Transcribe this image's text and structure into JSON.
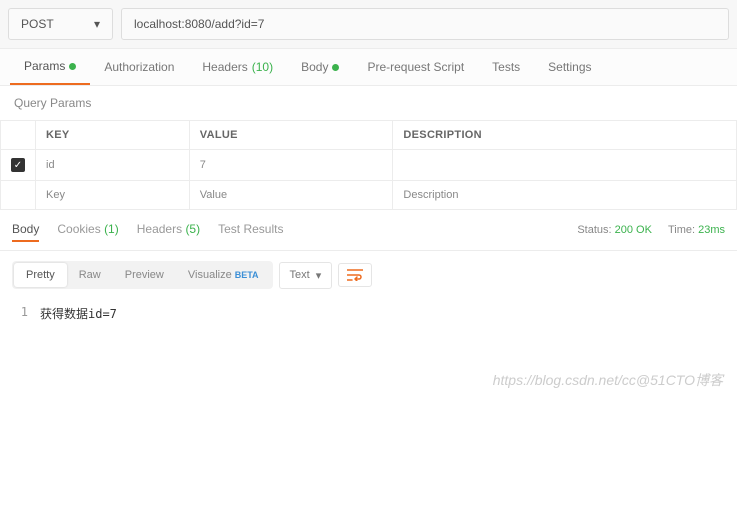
{
  "request": {
    "method": "POST",
    "url": "localhost:8080/add?id=7"
  },
  "reqTabs": {
    "params": "Params",
    "authorization": "Authorization",
    "headers": "Headers",
    "headersCount": "(10)",
    "body": "Body",
    "preRequest": "Pre-request Script",
    "tests": "Tests",
    "settings": "Settings"
  },
  "queryParams": {
    "title": "Query Params",
    "headers": {
      "key": "KEY",
      "value": "VALUE",
      "desc": "DESCRIPTION"
    },
    "rows": [
      {
        "checked": true,
        "key": "id",
        "value": "7",
        "desc": ""
      }
    ],
    "placeholder": {
      "key": "Key",
      "value": "Value",
      "desc": "Description"
    }
  },
  "respTabs": {
    "body": "Body",
    "cookies": "Cookies",
    "cookiesCount": "(1)",
    "headers": "Headers",
    "headersCount": "(5)",
    "testResults": "Test Results"
  },
  "respMeta": {
    "statusLabel": "Status:",
    "statusValue": "200 OK",
    "timeLabel": "Time:",
    "timeValue": "23ms"
  },
  "viewTabs": {
    "pretty": "Pretty",
    "raw": "Raw",
    "preview": "Preview",
    "visualize": "Visualize",
    "beta": "BETA",
    "type": "Text"
  },
  "response": {
    "line1No": "1",
    "line1": "获得数据id=7"
  },
  "watermark": "https://blog.csdn.net/cc@51CTO博客"
}
